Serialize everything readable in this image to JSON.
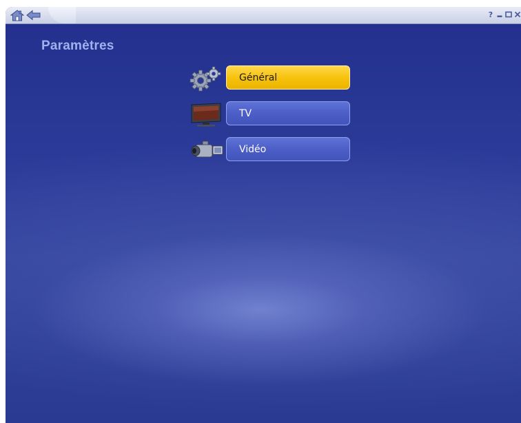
{
  "header": {
    "home_icon": "home-icon",
    "back_icon": "back-arrow-icon",
    "help_glyph": "?",
    "window_controls": [
      "help-icon",
      "minimize-icon",
      "maximize-icon",
      "close-icon"
    ]
  },
  "page": {
    "title": "Paramètres"
  },
  "menu": {
    "items": [
      {
        "label": "Général",
        "icon": "gears-icon",
        "selected": true
      },
      {
        "label": "TV",
        "icon": "television-icon",
        "selected": false
      },
      {
        "label": "Vidéo",
        "icon": "camcorder-icon",
        "selected": false
      }
    ]
  },
  "colors": {
    "background_blue": "#2b3a98",
    "title_color": "#9eb3ee",
    "button_blue": "#4b5dc6",
    "button_selected": "#f6c10a"
  }
}
